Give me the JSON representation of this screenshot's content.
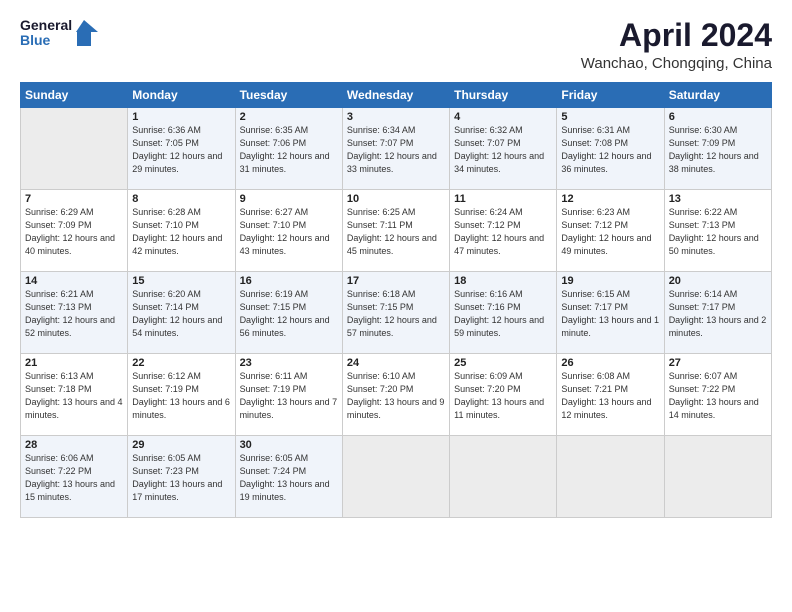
{
  "logo": {
    "line1": "General",
    "line2": "Blue"
  },
  "title": "April 2024",
  "subtitle": "Wanchao, Chongqing, China",
  "weekdays": [
    "Sunday",
    "Monday",
    "Tuesday",
    "Wednesday",
    "Thursday",
    "Friday",
    "Saturday"
  ],
  "weeks": [
    [
      {
        "num": "",
        "info": ""
      },
      {
        "num": "1",
        "info": "Sunrise: 6:36 AM\nSunset: 7:05 PM\nDaylight: 12 hours\nand 29 minutes."
      },
      {
        "num": "2",
        "info": "Sunrise: 6:35 AM\nSunset: 7:06 PM\nDaylight: 12 hours\nand 31 minutes."
      },
      {
        "num": "3",
        "info": "Sunrise: 6:34 AM\nSunset: 7:07 PM\nDaylight: 12 hours\nand 33 minutes."
      },
      {
        "num": "4",
        "info": "Sunrise: 6:32 AM\nSunset: 7:07 PM\nDaylight: 12 hours\nand 34 minutes."
      },
      {
        "num": "5",
        "info": "Sunrise: 6:31 AM\nSunset: 7:08 PM\nDaylight: 12 hours\nand 36 minutes."
      },
      {
        "num": "6",
        "info": "Sunrise: 6:30 AM\nSunset: 7:09 PM\nDaylight: 12 hours\nand 38 minutes."
      }
    ],
    [
      {
        "num": "7",
        "info": "Sunrise: 6:29 AM\nSunset: 7:09 PM\nDaylight: 12 hours\nand 40 minutes."
      },
      {
        "num": "8",
        "info": "Sunrise: 6:28 AM\nSunset: 7:10 PM\nDaylight: 12 hours\nand 42 minutes."
      },
      {
        "num": "9",
        "info": "Sunrise: 6:27 AM\nSunset: 7:10 PM\nDaylight: 12 hours\nand 43 minutes."
      },
      {
        "num": "10",
        "info": "Sunrise: 6:25 AM\nSunset: 7:11 PM\nDaylight: 12 hours\nand 45 minutes."
      },
      {
        "num": "11",
        "info": "Sunrise: 6:24 AM\nSunset: 7:12 PM\nDaylight: 12 hours\nand 47 minutes."
      },
      {
        "num": "12",
        "info": "Sunrise: 6:23 AM\nSunset: 7:12 PM\nDaylight: 12 hours\nand 49 minutes."
      },
      {
        "num": "13",
        "info": "Sunrise: 6:22 AM\nSunset: 7:13 PM\nDaylight: 12 hours\nand 50 minutes."
      }
    ],
    [
      {
        "num": "14",
        "info": "Sunrise: 6:21 AM\nSunset: 7:13 PM\nDaylight: 12 hours\nand 52 minutes."
      },
      {
        "num": "15",
        "info": "Sunrise: 6:20 AM\nSunset: 7:14 PM\nDaylight: 12 hours\nand 54 minutes."
      },
      {
        "num": "16",
        "info": "Sunrise: 6:19 AM\nSunset: 7:15 PM\nDaylight: 12 hours\nand 56 minutes."
      },
      {
        "num": "17",
        "info": "Sunrise: 6:18 AM\nSunset: 7:15 PM\nDaylight: 12 hours\nand 57 minutes."
      },
      {
        "num": "18",
        "info": "Sunrise: 6:16 AM\nSunset: 7:16 PM\nDaylight: 12 hours\nand 59 minutes."
      },
      {
        "num": "19",
        "info": "Sunrise: 6:15 AM\nSunset: 7:17 PM\nDaylight: 13 hours\nand 1 minute."
      },
      {
        "num": "20",
        "info": "Sunrise: 6:14 AM\nSunset: 7:17 PM\nDaylight: 13 hours\nand 2 minutes."
      }
    ],
    [
      {
        "num": "21",
        "info": "Sunrise: 6:13 AM\nSunset: 7:18 PM\nDaylight: 13 hours\nand 4 minutes."
      },
      {
        "num": "22",
        "info": "Sunrise: 6:12 AM\nSunset: 7:19 PM\nDaylight: 13 hours\nand 6 minutes."
      },
      {
        "num": "23",
        "info": "Sunrise: 6:11 AM\nSunset: 7:19 PM\nDaylight: 13 hours\nand 7 minutes."
      },
      {
        "num": "24",
        "info": "Sunrise: 6:10 AM\nSunset: 7:20 PM\nDaylight: 13 hours\nand 9 minutes."
      },
      {
        "num": "25",
        "info": "Sunrise: 6:09 AM\nSunset: 7:20 PM\nDaylight: 13 hours\nand 11 minutes."
      },
      {
        "num": "26",
        "info": "Sunrise: 6:08 AM\nSunset: 7:21 PM\nDaylight: 13 hours\nand 12 minutes."
      },
      {
        "num": "27",
        "info": "Sunrise: 6:07 AM\nSunset: 7:22 PM\nDaylight: 13 hours\nand 14 minutes."
      }
    ],
    [
      {
        "num": "28",
        "info": "Sunrise: 6:06 AM\nSunset: 7:22 PM\nDaylight: 13 hours\nand 15 minutes."
      },
      {
        "num": "29",
        "info": "Sunrise: 6:05 AM\nSunset: 7:23 PM\nDaylight: 13 hours\nand 17 minutes."
      },
      {
        "num": "30",
        "info": "Sunrise: 6:05 AM\nSunset: 7:24 PM\nDaylight: 13 hours\nand 19 minutes."
      },
      {
        "num": "",
        "info": ""
      },
      {
        "num": "",
        "info": ""
      },
      {
        "num": "",
        "info": ""
      },
      {
        "num": "",
        "info": ""
      }
    ]
  ]
}
